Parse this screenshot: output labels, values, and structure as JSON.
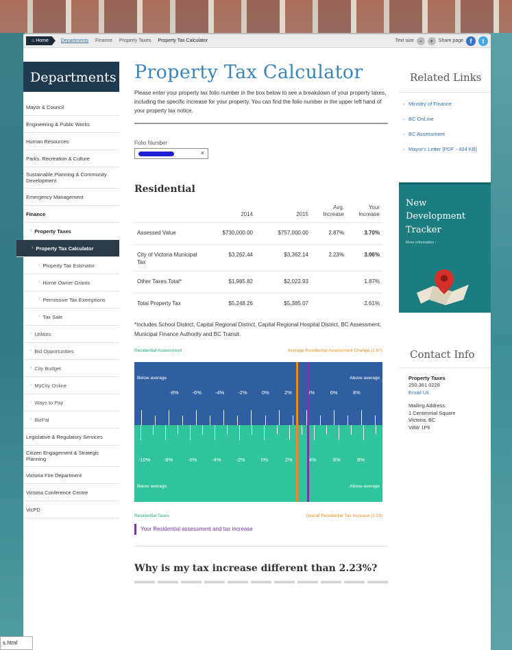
{
  "breadcrumb": {
    "home": "Home",
    "items": [
      "Departments",
      "Finance",
      "Property Taxes",
      "Property Tax Calculator"
    ],
    "text_size": "Text size",
    "share": "Share page"
  },
  "sidebar": {
    "heading": "Departments",
    "items": [
      "Mayor & Council",
      "Engineering & Public Works",
      "Human Resources",
      "Parks, Recreation & Culture",
      "Sustainable Planning & Community Development",
      "Emergency Management",
      "Finance",
      "Property Taxes",
      "Property Tax Calculator",
      "Property Tax Estimator",
      "Home Owner Grants",
      "Permissive Tax Exemptions",
      "Tax Sale",
      "Utilities",
      "Bid Opportunities",
      "City Budget",
      "MyCity Online",
      "Ways to Pay",
      "BizPal",
      "Legislative & Regulatory Services",
      "Citizen Engagement & Strategic Planning",
      "Victoria Fire Department",
      "Victoria Conference Centre",
      "VicPD"
    ]
  },
  "main": {
    "title": "Property Tax Calculator",
    "intro": "Please enter your property tax folio number in the box below to see a breakdown of your property taxes, including the specific increase for your property. You can find the folio number in the upper left hand of your property tax notice.",
    "folio_label": "Folio Number",
    "folio_clear": "×",
    "residential_title": "Residential",
    "table": {
      "headers": [
        "",
        "2014",
        "2015",
        "Avg. Increase",
        "Your Increase"
      ],
      "rows": [
        [
          "Assessed Value",
          "$730,000.00",
          "$757,000.00",
          "2.87%",
          "3.70%"
        ],
        [
          "City of Victoria Municipal Tax",
          "$3,262.44",
          "$3,362.14",
          "2.23%",
          "3.06%"
        ],
        [
          "Other Taxes Total*",
          "$1,985.82",
          "$2,022.93",
          "",
          "1.87%"
        ],
        [
          "Total Property Tax",
          "$5,248.26",
          "$5,385.07",
          "",
          "2.61%"
        ]
      ]
    },
    "footnote": "*Includes School District, Capital Regional District, Capital Regional Hospital District, BC Assessment, Municipal Finance Authority and BC Transit.",
    "chart": {
      "label_assessment": "Residential Assessment",
      "label_avg_assessment": "Average Residential Assessment Change (2.87)",
      "below_average": "Below average",
      "above_average": "Above average",
      "top_ticks": [
        "-8%",
        "-6%",
        "-4%",
        "-2%",
        "0%",
        "2%",
        "4%",
        "6%",
        "8%"
      ],
      "bottom_ticks": [
        "-10%",
        "-8%",
        "-6%",
        "-4%",
        "-2%",
        "0%",
        "2%",
        "4%",
        "6%",
        "8%"
      ],
      "label_taxes": "Residential Taxes",
      "label_avg_taxes": "Overall Residential Tax Increase (2.23)",
      "legend": "Your Residential assessment and tax increase",
      "colors": {
        "blue": "#2f5fa0",
        "green": "#2fc49a",
        "orange": "#e88b1b",
        "purple": "#7a35a8"
      }
    },
    "why_heading": "Why is my tax increase different than 2.23%?"
  },
  "right": {
    "related_title": "Related Links",
    "links": [
      "Ministry of Finance",
      "BC OnLine",
      "BC Assessment",
      "Mayor's Letter [PDF - 424 KB]"
    ],
    "tracker_title": "New Development Tracker",
    "tracker_more": "More information ›",
    "contact_title": "Contact Info",
    "contact_name": "Property Taxes",
    "contact_phone": "250.361.0228",
    "contact_email": "Email Us",
    "mailing_label": "Mailing Address:",
    "mailing_line1": "1 Centennial Square",
    "mailing_line2": "Victoria, BC",
    "mailing_line3": "V8W 1P6"
  },
  "status_tab": "s.html"
}
